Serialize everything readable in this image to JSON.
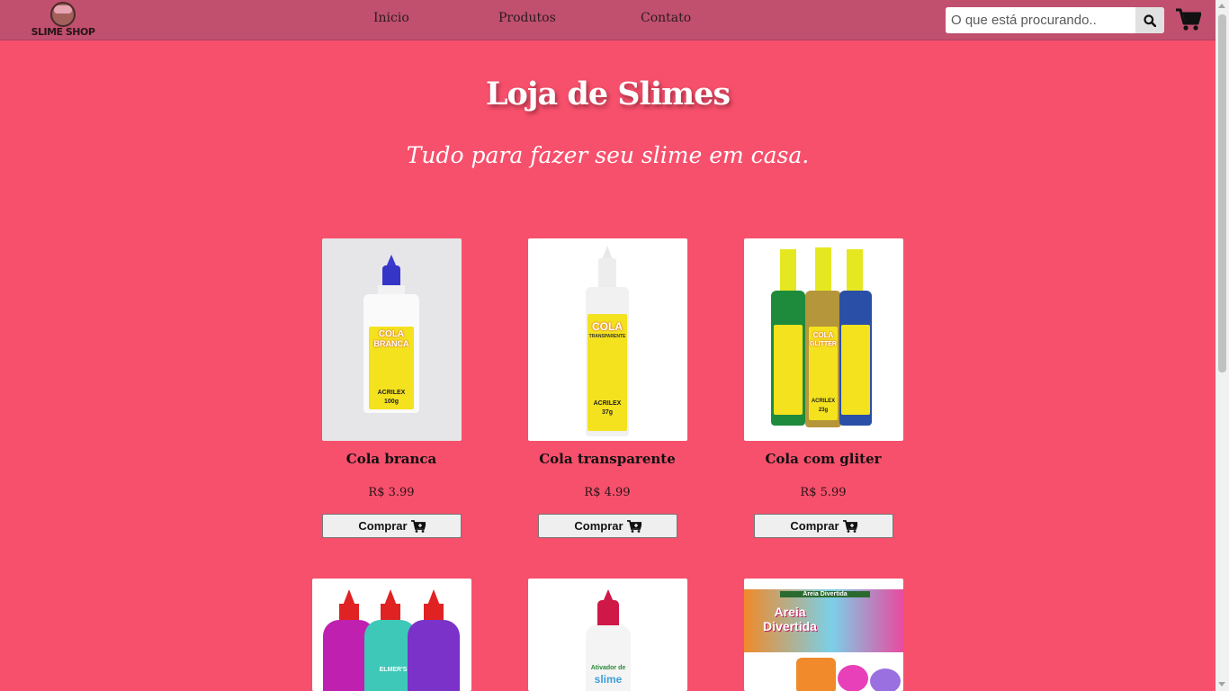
{
  "brand": {
    "name": "SLIME SHOP"
  },
  "nav": {
    "links": [
      "Inicio",
      "Produtos",
      "Contato"
    ]
  },
  "search": {
    "placeholder": "O que está procurando.."
  },
  "hero": {
    "title": "Loja de Slimes",
    "subtitle": "Tudo para fazer seu slime em casa."
  },
  "products": [
    {
      "name": "Cola branca",
      "price": "R$ 3.99",
      "button": "Comprar",
      "image_text": [
        "COLA",
        "BRANCA",
        "ACRILEX",
        "100g"
      ]
    },
    {
      "name": "Cola transparente",
      "price": "R$ 4.99",
      "button": "Comprar",
      "image_text": [
        "COLA",
        "TRANSPARENTE",
        "ACRILEX",
        "37g"
      ]
    },
    {
      "name": "Cola com gliter",
      "price": "R$ 5.99",
      "button": "Comprar",
      "image_text": [
        "COLA",
        "GLITTER",
        "ACRILEX",
        "23g"
      ]
    }
  ],
  "products_row2": [
    {
      "image_text": [
        "ELMER'S"
      ]
    },
    {
      "image_text": [
        "Ativador de",
        "slime"
      ]
    },
    {
      "image_text": [
        "Areia Divertida",
        "Areia",
        "Divertida"
      ]
    }
  ],
  "colors": {
    "background": "#f7506c",
    "navbar": "#c0506e",
    "button_bg": "#efefef"
  },
  "icons": [
    "search-icon",
    "cart-icon",
    "cart-plus-icon"
  ]
}
